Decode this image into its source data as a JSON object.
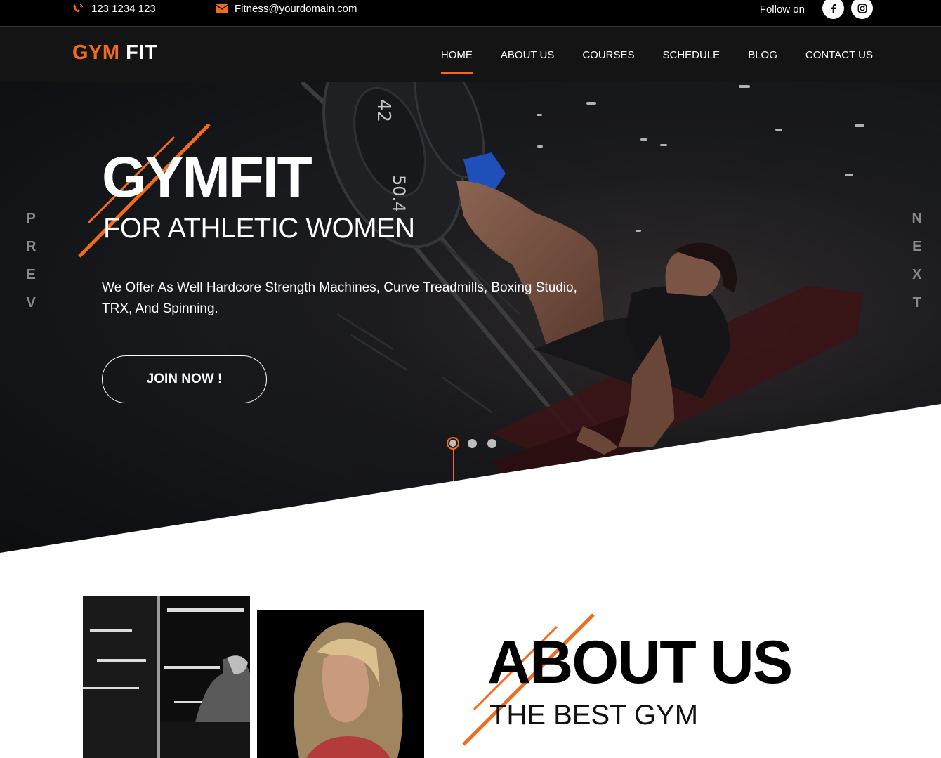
{
  "topbar": {
    "phone": "123 1234 123",
    "email": "Fitness@yourdomain.com",
    "follow_label": "Follow on",
    "social": [
      {
        "name": "facebook-icon",
        "glyph": "f"
      },
      {
        "name": "instagram-icon",
        "glyph": ""
      }
    ]
  },
  "header": {
    "logo_part1": "GYM",
    "logo_part2": "FIT",
    "nav": [
      {
        "label": "HOME",
        "active": true
      },
      {
        "label": "ABOUT US",
        "active": false
      },
      {
        "label": "COURSES",
        "active": false
      },
      {
        "label": "SCHEDULE",
        "active": false
      },
      {
        "label": "BLOG",
        "active": false
      },
      {
        "label": "CONTACT US",
        "active": false
      }
    ]
  },
  "hero": {
    "title": "GYMFIT",
    "subtitle": "FOR ATHLETIC WOMEN",
    "text": "We Offer As Well Hardcore Strength Machines, Curve Treadmills, Boxing Studio, TRX, And Spinning.",
    "button": "JOIN NOW !",
    "prev_letters": [
      "P",
      "R",
      "E",
      "V"
    ],
    "next_letters": [
      "N",
      "E",
      "X",
      "T"
    ],
    "slides_total": 3,
    "active_slide": 1,
    "plate_labels": [
      "42",
      "50.4"
    ]
  },
  "about": {
    "title": "ABOUT US",
    "subtitle": "THE BEST GYM"
  },
  "colors": {
    "accent": "#f26b1d",
    "topbar_bg": "#000000",
    "header_bg": "#0c0c0c",
    "hero_bg": "#16171a"
  }
}
